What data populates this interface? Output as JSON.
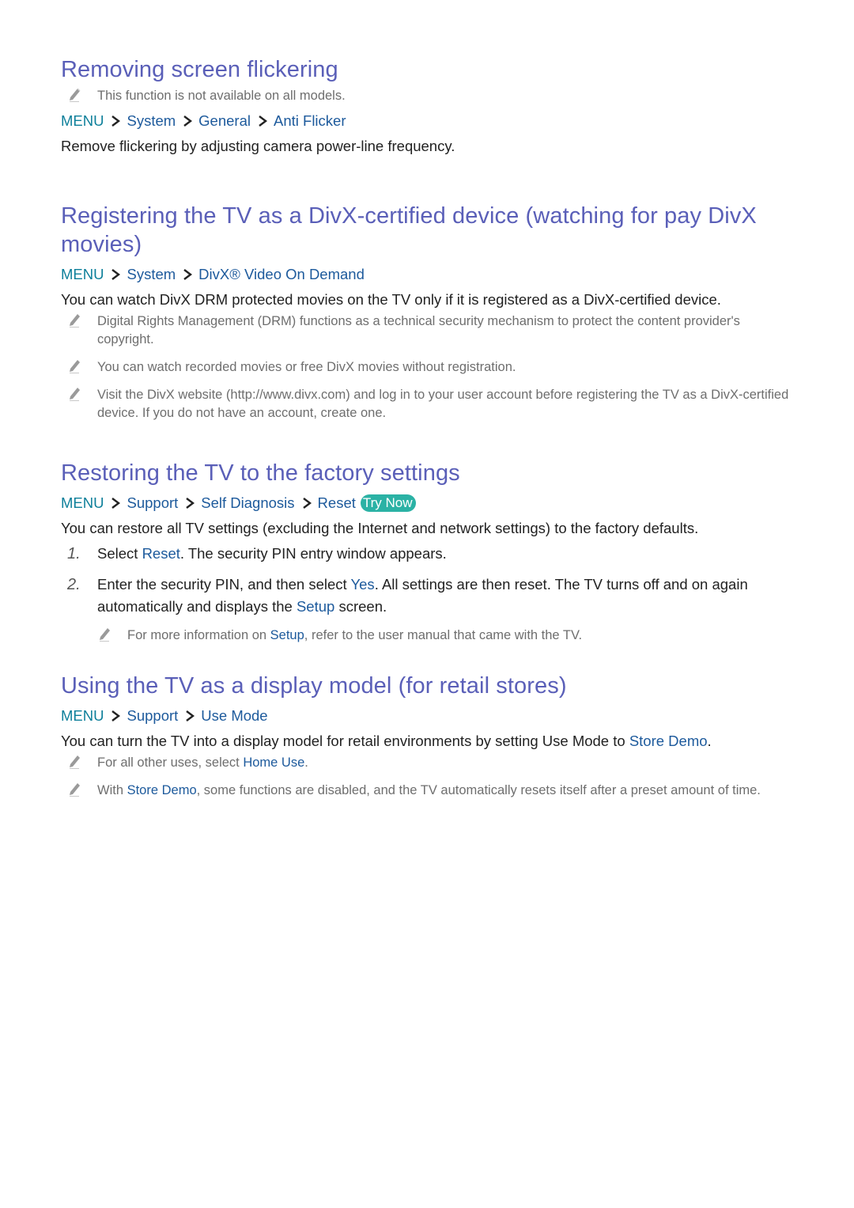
{
  "colors": {
    "heading": "#5a5fb8",
    "menu": "#0d7f9a",
    "link": "#1d5a9c",
    "body_text": "#222222",
    "note_text": "#6e6e6e",
    "try_now_bg": "#2bb2a5"
  },
  "icons": {
    "note": "pencil-icon",
    "path_separator": "chevron-right-icon"
  },
  "sections": [
    {
      "title": "Removing screen flickering",
      "pre_note": "This function is not available on all models.",
      "path": [
        "MENU",
        "System",
        "General",
        "Anti Flicker"
      ],
      "body": "Remove flickering by adjusting camera power-line frequency."
    },
    {
      "title": "Registering the TV as a DivX-certified device (watching for pay DivX movies)",
      "path": [
        "MENU",
        "System",
        "DivX® Video On Demand"
      ],
      "body": "You can watch DivX DRM protected movies on the TV only if it is registered as a DivX-certified device.",
      "notes": [
        "Digital Rights Management (DRM) functions as a technical security mechanism to protect the content provider's copyright.",
        "You can watch recorded movies or free DivX movies without registration.",
        "Visit the DivX website (http://www.divx.com) and log in to your user account before registering the TV as a DivX-certified device. If you do not have an account, create one."
      ]
    },
    {
      "title": "Restoring the TV to the factory settings",
      "path": [
        "MENU",
        "Support",
        "Self Diagnosis",
        "Reset"
      ],
      "try_now": "Try Now",
      "body": "You can restore all TV settings (excluding the Internet and network settings) to the factory defaults.",
      "steps": [
        {
          "num": "1.",
          "parts": [
            "Select ",
            "Reset",
            ". The security PIN entry window appears."
          ]
        },
        {
          "num": "2.",
          "parts": [
            "Enter the security PIN, and then select ",
            "Yes",
            ". All settings are then reset. The TV turns off and on again automatically and displays the ",
            "Setup",
            " screen."
          ]
        }
      ],
      "step_note": [
        "For more information on ",
        "Setup",
        ", refer to the user manual that came with the TV."
      ]
    },
    {
      "title": "Using the TV as a display model (for retail stores)",
      "path": [
        "MENU",
        "Support",
        "Use Mode"
      ],
      "body_parts": [
        "You can turn the TV into a display model for retail environments by setting Use Mode to ",
        "Store Demo",
        "."
      ],
      "notes_parts": [
        [
          "For all other uses, select ",
          "Home Use",
          "."
        ],
        [
          "With ",
          "Store Demo",
          ", some functions are disabled, and the TV automatically resets itself after a preset amount of time."
        ]
      ]
    }
  ]
}
